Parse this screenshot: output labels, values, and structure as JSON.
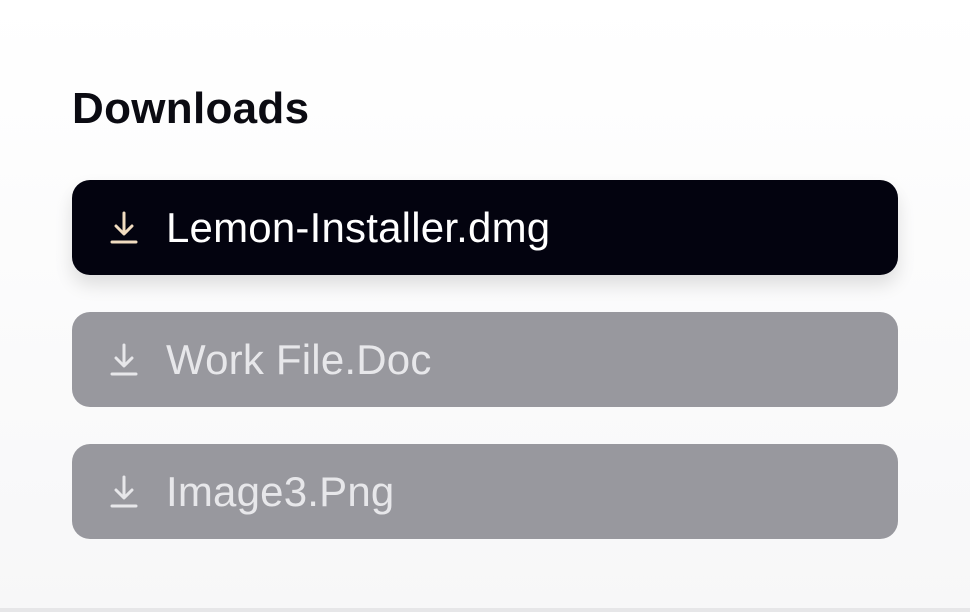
{
  "page": {
    "title": "Downloads"
  },
  "downloads": [
    {
      "label": "Lemon-Installer.dmg",
      "state": "active",
      "icon": "download-icon",
      "icon_color": "#f1dcc0"
    },
    {
      "label": "Work File.Doc",
      "state": "inactive",
      "icon": "download-icon",
      "icon_color": "#e7e7ea"
    },
    {
      "label": "Image3.Png",
      "state": "inactive",
      "icon": "download-icon",
      "icon_color": "#e7e7ea"
    }
  ],
  "colors": {
    "active_bg": "#03030f",
    "inactive_bg": "#98989e",
    "active_text": "#ffffff",
    "inactive_text": "#e7e7ea",
    "title_text": "#0b0b12"
  }
}
